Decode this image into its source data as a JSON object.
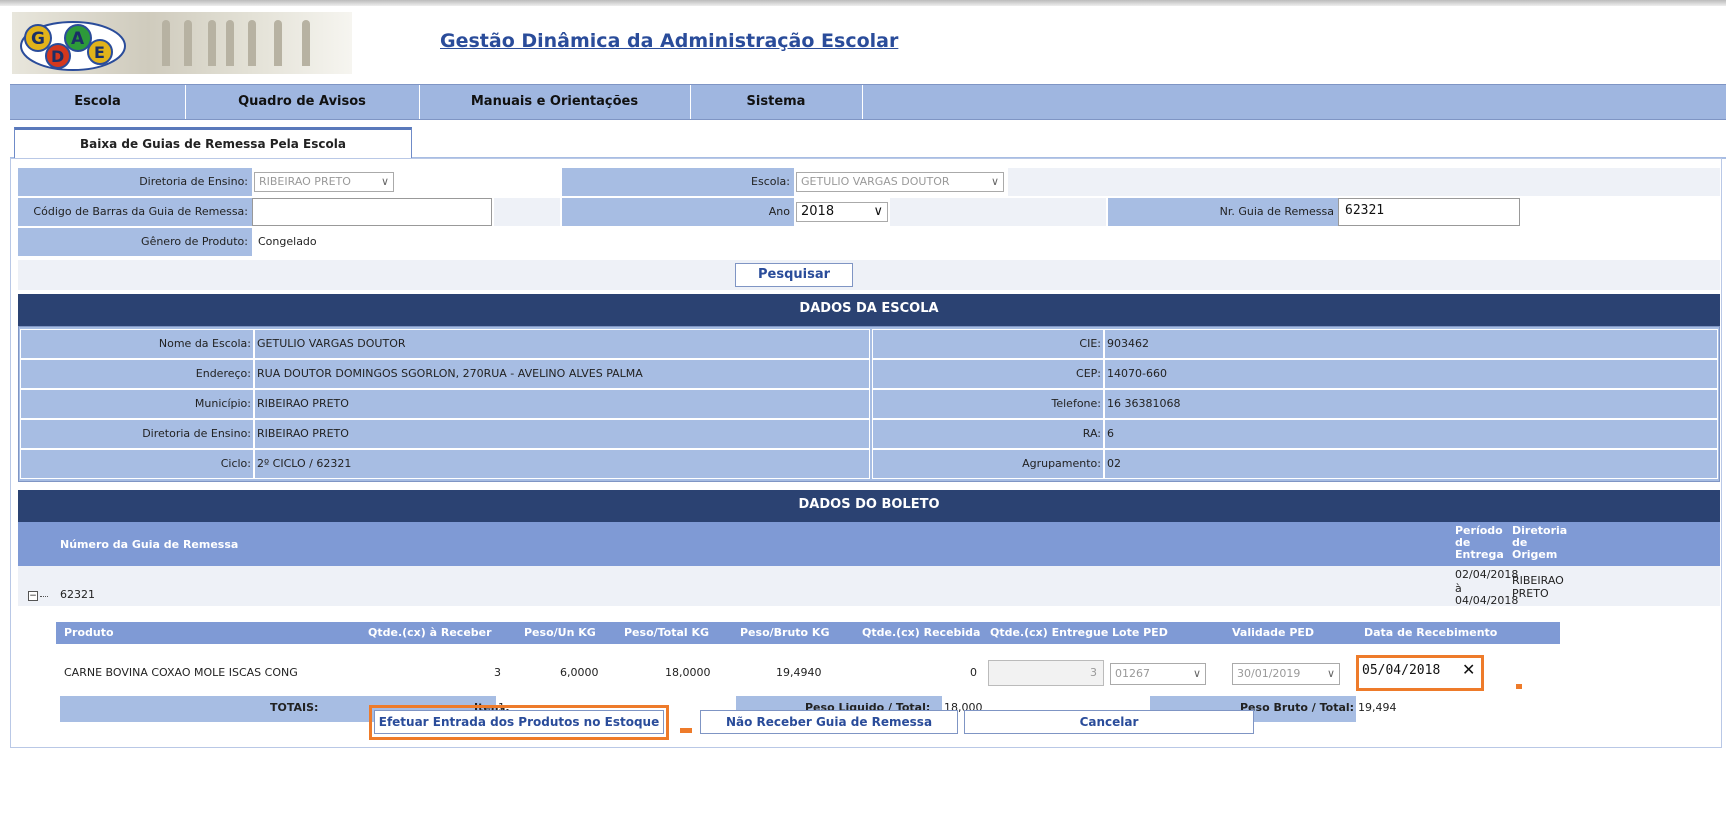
{
  "header": {
    "logo_text": "GDAE",
    "title": "Gestão Dinâmica da Administração Escolar"
  },
  "nav": [
    "Escola",
    "Quadro de Avisos",
    "Manuais e Orientações",
    "Sistema"
  ],
  "tab": "Baixa de Guias de Remessa Pela Escola",
  "filters": {
    "diretoria_label": "Diretoria de Ensino:",
    "diretoria_value": "RIBEIRAO PRETO",
    "escola_label": "Escola:",
    "escola_value": "GETULIO VARGAS DOUTOR",
    "codigo_label": "Código de Barras da Guia de Remessa:",
    "codigo_value": "",
    "ano_label": "Ano",
    "ano_value": "2018",
    "guia_label": "Nr. Guia de Remessa",
    "guia_value": "62321",
    "genero_label": "Gênero de Produto:",
    "genero_value": "Congelado",
    "search_button": "Pesquisar"
  },
  "school": {
    "section_title": "DADOS DA ESCOLA",
    "rows": [
      {
        "l1": "Nome da Escola:",
        "v1": "GETULIO VARGAS DOUTOR",
        "l2": "CIE:",
        "v2": "903462"
      },
      {
        "l1": "Endereço:",
        "v1": "RUA DOUTOR DOMINGOS SGORLON, 270RUA - AVELINO ALVES PALMA",
        "l2": "CEP:",
        "v2": "14070-660"
      },
      {
        "l1": "Município:",
        "v1": "RIBEIRAO PRETO",
        "l2": "Telefone:",
        "v2": "16 36381068"
      },
      {
        "l1": "Diretoria de Ensino:",
        "v1": "RIBEIRAO PRETO",
        "l2": "RA:",
        "v2": "6"
      },
      {
        "l1": "Ciclo:",
        "v1": "2º CICLO / 62321",
        "l2": "Agrupamento:",
        "v2": "02"
      }
    ]
  },
  "boleto": {
    "section_title": "DADOS DO BOLETO",
    "header_numero": "Número da Guia de Remessa",
    "header_periodo": "Período de Entrega",
    "header_diretoria": "Diretoria de Origem",
    "guia_number": "62321",
    "periodo_start": "02/04/2018",
    "periodo_sep": "à",
    "periodo_end": "04/04/2018",
    "diretoria_origem_1": "RIBEIRAO",
    "diretoria_origem_2": "PRETO",
    "columns": [
      "Produto",
      "Qtde.(cx) à Receber",
      "Peso/Un KG",
      "Peso/Total KG",
      "Peso/Bruto KG",
      "Qtde.(cx) Recebida",
      "Qtde.(cx) Entregue",
      "Lote PED",
      "Validade PED",
      "Data de Recebimento"
    ],
    "item": {
      "produto": "CARNE BOVINA COXAO MOLE ISCAS CONG",
      "qtde_receber": "3",
      "peso_un": "6,0000",
      "peso_total": "18,0000",
      "peso_bruto": "19,4940",
      "qtde_recebida": "0",
      "qtde_entregue": "3",
      "lote": "01267",
      "validade": "30/01/2019",
      "data_recebimento": "05/04/2018"
    },
    "totais": {
      "label": "TOTAIS:",
      "itens_label": "Itens:",
      "itens_value": "1",
      "peso_liquido_label": "Peso Liquido / Total:",
      "peso_liquido_value": "18,000",
      "peso_bruto_label": "Peso Bruto / Total:",
      "peso_bruto_value": "19,494"
    }
  },
  "actions": {
    "efetuar": "Efetuar Entrada dos Produtos no Estoque",
    "nao_receber": "Não Receber Guia de Remessa",
    "cancelar": "Cancelar"
  },
  "colors": {
    "nav": "#9fb6e0",
    "label_bg": "#a7bde3",
    "section": "#2b4272",
    "grid_header": "#7f9ad5",
    "highlight": "#ee7b2a",
    "title": "#2a4c9a"
  }
}
